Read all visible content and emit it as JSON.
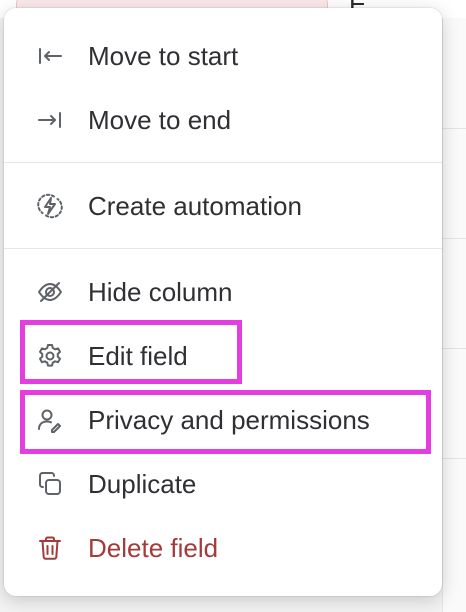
{
  "menu": {
    "items": [
      {
        "id": "move-start",
        "label": "Move to start",
        "icon": "arrow-to-start-icon"
      },
      {
        "id": "move-end",
        "label": "Move to end",
        "icon": "arrow-to-end-icon"
      },
      {
        "id": "create-automation",
        "label": "Create automation",
        "icon": "automation-bolt-icon"
      },
      {
        "id": "hide-column",
        "label": "Hide column",
        "icon": "eye-off-icon"
      },
      {
        "id": "edit-field",
        "label": "Edit field",
        "icon": "gear-icon"
      },
      {
        "id": "privacy",
        "label": "Privacy and permissions",
        "icon": "user-permissions-icon"
      },
      {
        "id": "duplicate",
        "label": "Duplicate",
        "icon": "duplicate-icon"
      },
      {
        "id": "delete-field",
        "label": "Delete field",
        "icon": "trash-icon"
      }
    ]
  },
  "background": {
    "partial_letter": "E"
  },
  "colors": {
    "text": "#2f3033",
    "icon": "#5f6368",
    "danger": "#a33b3b",
    "highlight": "#e53ee0"
  }
}
